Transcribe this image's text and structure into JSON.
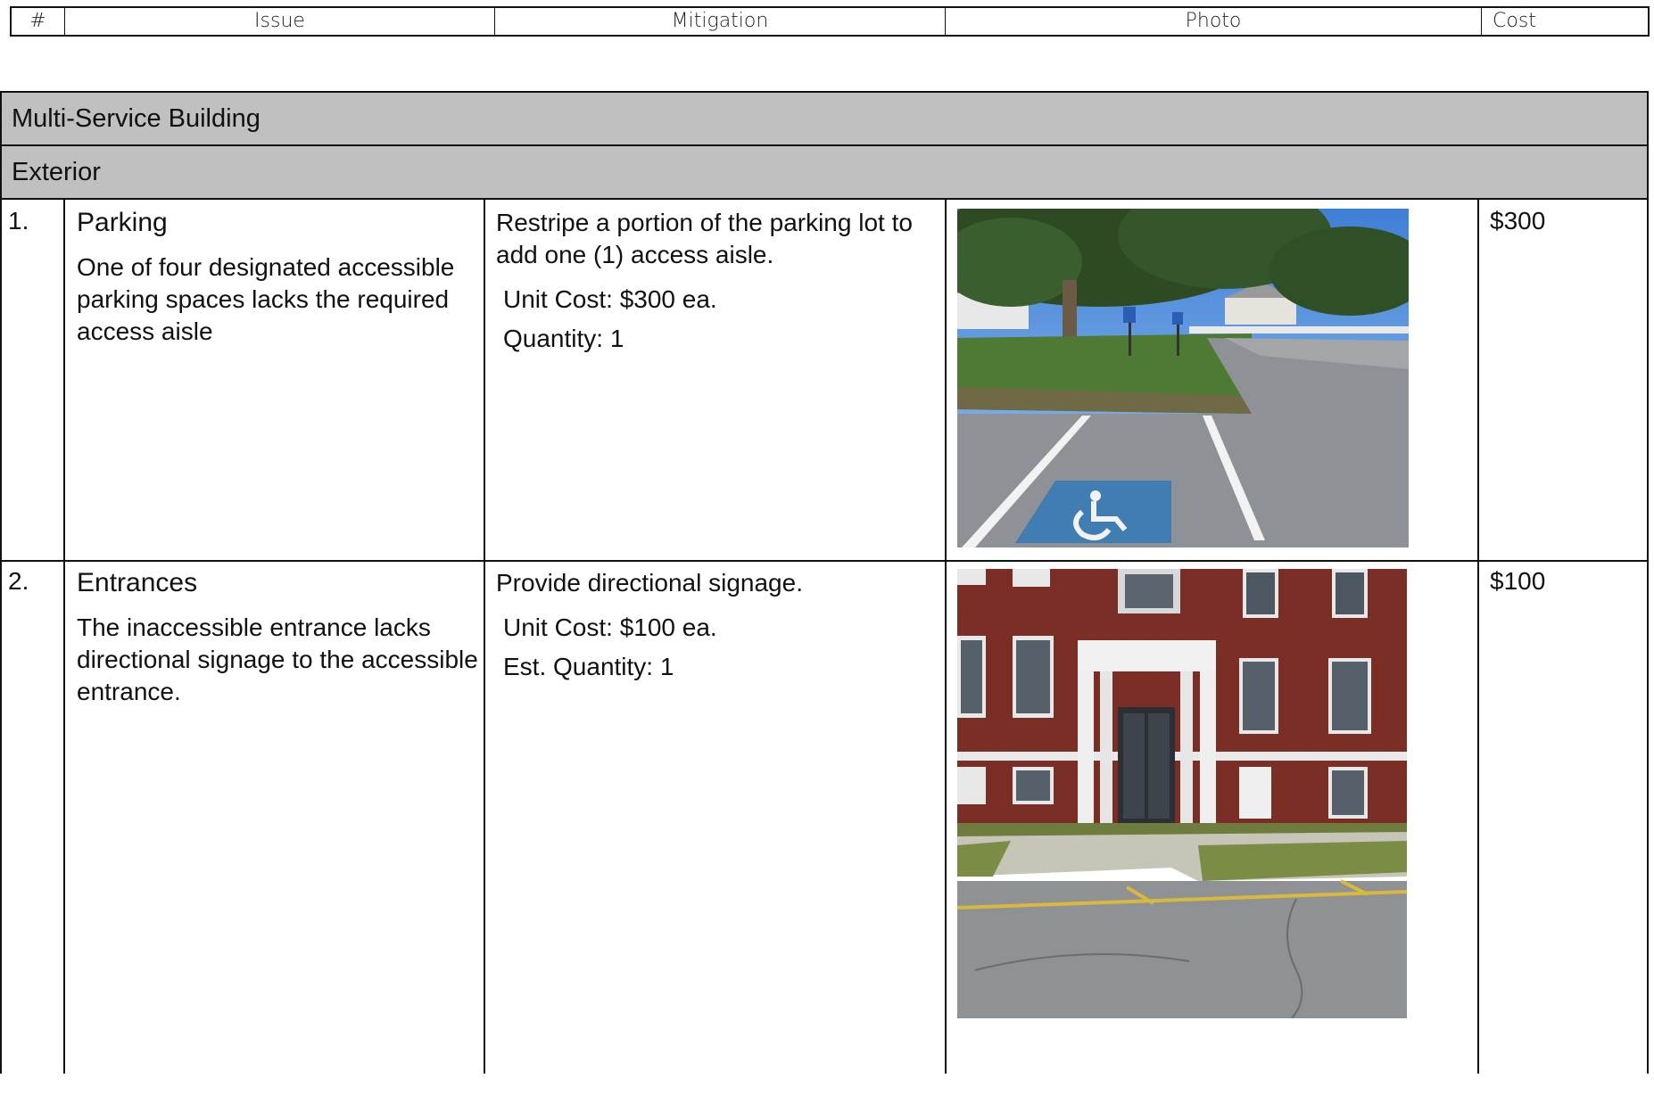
{
  "header": {
    "col_num": "#",
    "col_issue": "Issue",
    "col_mitigation": "Mitigation",
    "col_photo": "Photo",
    "col_cost": "Cost"
  },
  "section": "Multi-Service Building",
  "subsection": "Exterior",
  "rows": [
    {
      "num": "1.",
      "title": "Parking",
      "issue": "One of four designated accessible parking spaces lacks the required access aisle",
      "mitigation": "Restripe a portion of the parking lot to add one (1) access aisle.",
      "unit_cost": "Unit Cost: $300 ea.",
      "quantity": "Quantity: 1",
      "cost": "$300"
    },
    {
      "num": "2.",
      "title": "Entrances",
      "issue": "The inaccessible entrance lacks directional signage to the accessible entrance.",
      "mitigation": "Provide directional signage.",
      "unit_cost": "Unit Cost: $100 ea.",
      "quantity": "Est. Quantity: 1",
      "cost": "$100"
    }
  ],
  "colors": {
    "band": "#c0c0c0",
    "border": "#111111"
  }
}
